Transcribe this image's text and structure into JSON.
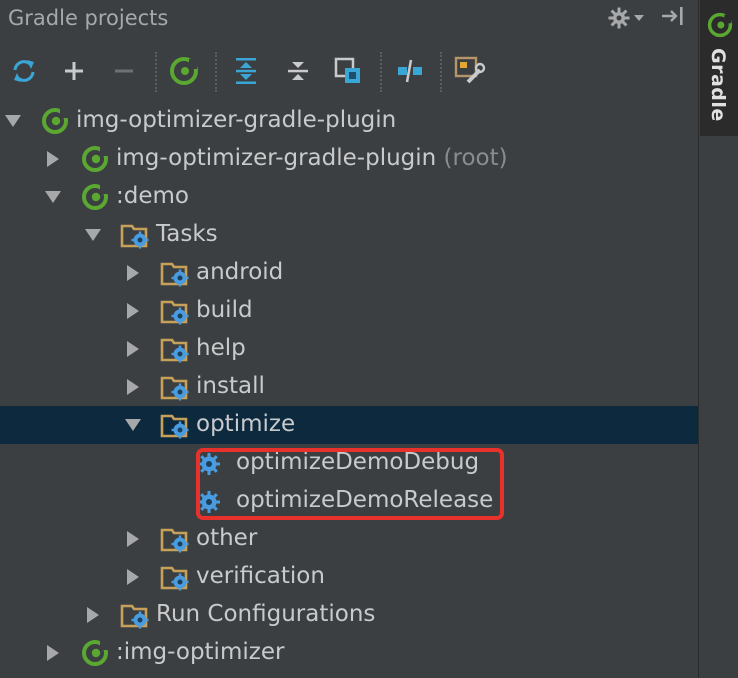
{
  "panel": {
    "title": "Gradle projects",
    "tool_icons": [
      "gear-icon",
      "hide-panel-icon"
    ]
  },
  "toolbar": {
    "buttons": [
      {
        "name": "refresh-button",
        "icon": "refresh-icon"
      },
      {
        "name": "add-button",
        "icon": "plus-icon"
      },
      {
        "name": "remove-button",
        "icon": "minus-icon"
      },
      {
        "name": "execute-task-button",
        "icon": "gradle-icon"
      },
      {
        "name": "expand-all-button",
        "icon": "expand-all-icon"
      },
      {
        "name": "collapse-all-button",
        "icon": "collapse-all-icon"
      },
      {
        "name": "attach-project-button",
        "icon": "attach-icon"
      },
      {
        "name": "toggle-offline-button",
        "icon": "offline-icon"
      },
      {
        "name": "settings-button",
        "icon": "wrench-icon"
      }
    ]
  },
  "colors": {
    "background": "#3c3f41",
    "selection": "#0d293e",
    "highlight_border": "#e8312b",
    "gradle_green": "#5aa832",
    "task_blue": "#4a9ce0",
    "folder": "#c7a15a"
  },
  "tree": {
    "rows": [
      {
        "label": "img-optimizer-gradle-plugin",
        "suffix": "",
        "icon": "gradle-icon",
        "expanded": true,
        "level": 0
      },
      {
        "label": "img-optimizer-gradle-plugin",
        "suffix": "(root)",
        "icon": "gradle-icon",
        "expanded": false,
        "level": 1
      },
      {
        "label": ":demo",
        "suffix": "",
        "icon": "gradle-icon",
        "expanded": true,
        "level": 1
      },
      {
        "label": "Tasks",
        "suffix": "",
        "icon": "task-folder-icon",
        "expanded": true,
        "level": 2
      },
      {
        "label": "android",
        "suffix": "",
        "icon": "task-folder-icon",
        "expanded": false,
        "level": 3
      },
      {
        "label": "build",
        "suffix": "",
        "icon": "task-folder-icon",
        "expanded": false,
        "level": 3
      },
      {
        "label": "help",
        "suffix": "",
        "icon": "task-folder-icon",
        "expanded": false,
        "level": 3
      },
      {
        "label": "install",
        "suffix": "",
        "icon": "task-folder-icon",
        "expanded": false,
        "level": 3
      },
      {
        "label": "optimize",
        "suffix": "",
        "icon": "task-folder-icon",
        "expanded": true,
        "level": 3,
        "selected": true
      },
      {
        "label": "optimizeDemoDebug",
        "suffix": "",
        "icon": "task-gear-icon",
        "level": 4
      },
      {
        "label": "optimizeDemoRelease",
        "suffix": "",
        "icon": "task-gear-icon",
        "level": 4
      },
      {
        "label": "other",
        "suffix": "",
        "icon": "task-folder-icon",
        "expanded": false,
        "level": 3
      },
      {
        "label": "verification",
        "suffix": "",
        "icon": "task-folder-icon",
        "expanded": false,
        "level": 3
      },
      {
        "label": "Run Configurations",
        "suffix": "",
        "icon": "task-folder-icon",
        "expanded": false,
        "level": 2
      },
      {
        "label": ":img-optimizer",
        "suffix": "",
        "icon": "gradle-icon",
        "expanded": false,
        "level": 1
      }
    ]
  },
  "sidebar": {
    "tab_label": "Gradle",
    "tab_icon": "gradle-icon"
  }
}
